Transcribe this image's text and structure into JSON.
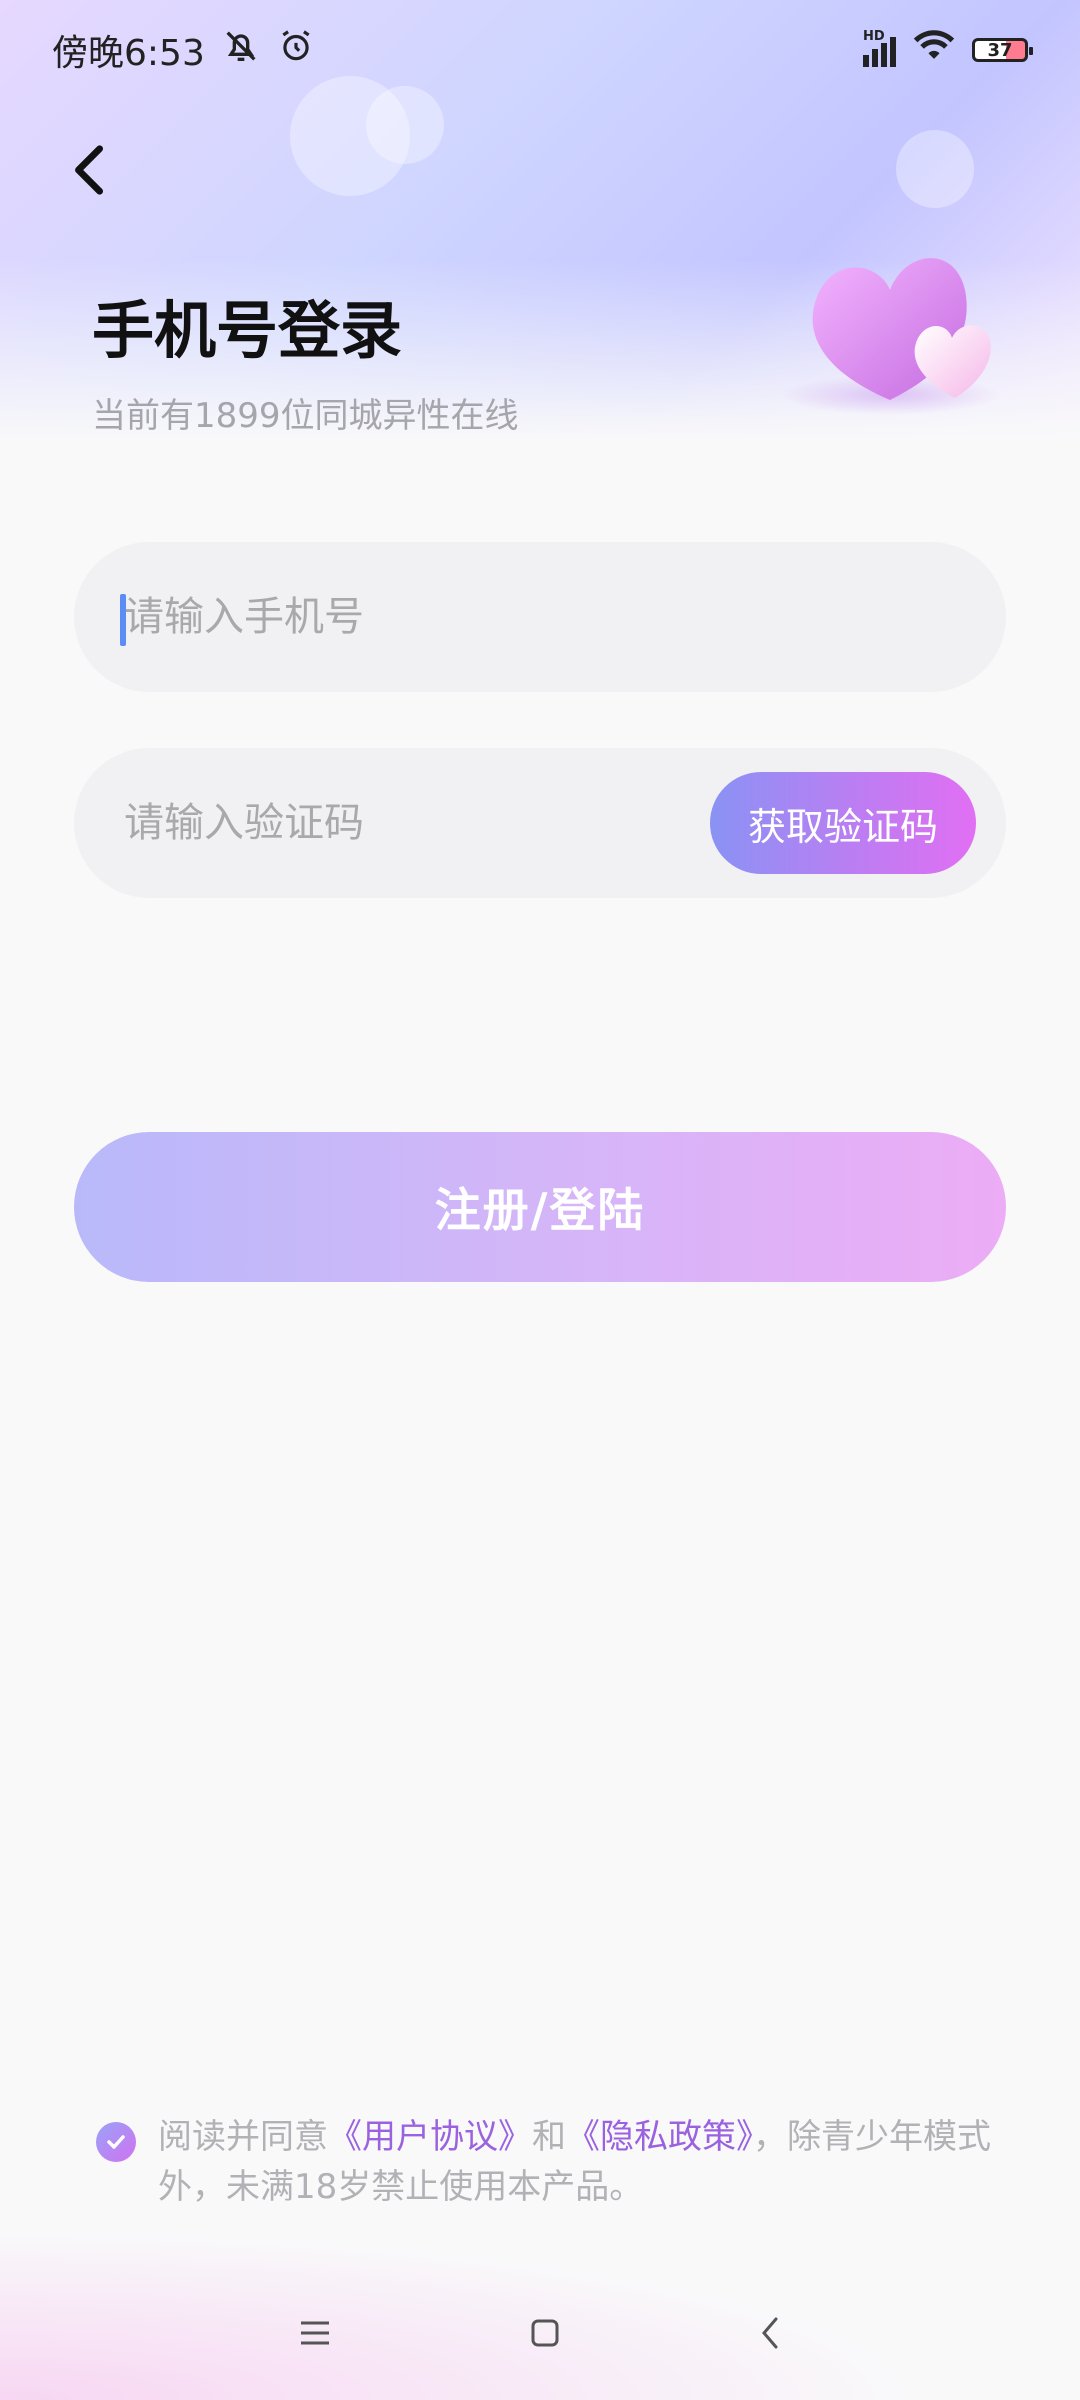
{
  "status_bar": {
    "time": "傍晚6:53",
    "battery_level": "37",
    "network_label": "HD"
  },
  "header": {
    "title": "手机号登录",
    "subtitle": "当前有1899位同城异性在线"
  },
  "form": {
    "phone_placeholder": "请输入手机号",
    "phone_value": "",
    "code_placeholder": "请输入验证码",
    "code_value": "",
    "get_code_label": "获取验证码",
    "submit_label": "注册/登陆"
  },
  "agreement": {
    "checked": true,
    "prefix": "阅读并同意",
    "user_agreement": "《用户协议》",
    "and": "和",
    "privacy_policy": "《隐私政策》",
    "suffix": "，除青少年模式外，未满18岁禁止使用本产品。"
  },
  "colors": {
    "accent_purple": "#9b62e0",
    "button_gradient_start": "#8a92f4",
    "button_gradient_end": "#e16ff3",
    "login_gradient_start": "#b9b9fa",
    "login_gradient_end": "#ecacf6"
  },
  "icons": {
    "back": "chevron-left-icon",
    "menu": "menu-icon",
    "home": "home-square-icon",
    "nav_back": "nav-back-icon",
    "check": "check-icon",
    "mute": "bell-off-icon",
    "alarm": "alarm-icon",
    "signal": "signal-icon",
    "wifi": "wifi-icon"
  }
}
